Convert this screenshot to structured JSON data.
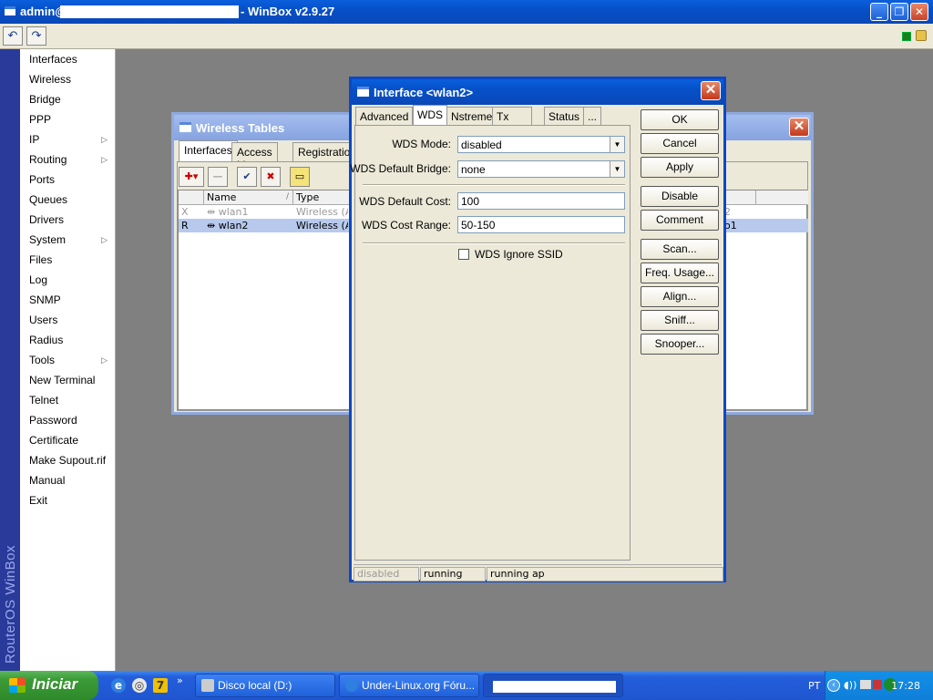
{
  "titlebar": {
    "title_prefix": "admin@",
    "title_suffix": "- WinBox v2.9.27"
  },
  "sidebar": {
    "brand": "RouterOS WinBox",
    "items": [
      {
        "label": "Interfaces",
        "arrow": false
      },
      {
        "label": "Wireless",
        "arrow": false
      },
      {
        "label": "Bridge",
        "arrow": false
      },
      {
        "label": "PPP",
        "arrow": false
      },
      {
        "label": "IP",
        "arrow": true
      },
      {
        "label": "Routing",
        "arrow": true
      },
      {
        "label": "Ports",
        "arrow": false
      },
      {
        "label": "Queues",
        "arrow": false
      },
      {
        "label": "Drivers",
        "arrow": false
      },
      {
        "label": "System",
        "arrow": true
      },
      {
        "label": "Files",
        "arrow": false
      },
      {
        "label": "Log",
        "arrow": false
      },
      {
        "label": "SNMP",
        "arrow": false
      },
      {
        "label": "Users",
        "arrow": false
      },
      {
        "label": "Radius",
        "arrow": false
      },
      {
        "label": "Tools",
        "arrow": true
      },
      {
        "label": "New Terminal",
        "arrow": false
      },
      {
        "label": "Telnet",
        "arrow": false
      },
      {
        "label": "Password",
        "arrow": false
      },
      {
        "label": "Certificate",
        "arrow": false
      },
      {
        "label": "Make Supout.rif",
        "arrow": false
      },
      {
        "label": "Manual",
        "arrow": false
      },
      {
        "label": "Exit",
        "arrow": false
      }
    ]
  },
  "wireless_tables": {
    "title": "Wireless Tables",
    "tabs": [
      "Interfaces",
      "Access List",
      "Registration"
    ],
    "columns": {
      "name": "Name",
      "type": "Type"
    },
    "rows": [
      {
        "flag": "X",
        "name": "wlan1",
        "type": "Wireless (Ath",
        "extra": "2"
      },
      {
        "flag": "R",
        "name": "wlan2",
        "type": "Wireless (Ath",
        "extra": "o1"
      }
    ]
  },
  "dialog": {
    "title": "Interface <wlan2>",
    "tabs": [
      "Advanced",
      "WDS",
      "Nstreme",
      "Tx Power",
      "Status",
      "..."
    ],
    "active_tab": "WDS",
    "fields": {
      "wds_mode_label": "WDS Mode:",
      "wds_mode_value": "disabled",
      "wds_bridge_label": "WDS Default Bridge:",
      "wds_bridge_value": "none",
      "wds_cost_label": "WDS Default Cost:",
      "wds_cost_value": "100",
      "wds_range_label": "WDS Cost Range:",
      "wds_range_value": "50-150",
      "wds_ignore_label": "WDS Ignore SSID"
    },
    "buttons": {
      "ok": "OK",
      "cancel": "Cancel",
      "apply": "Apply",
      "disable": "Disable",
      "comment": "Comment",
      "scan": "Scan...",
      "freq": "Freq. Usage...",
      "align": "Align...",
      "sniff": "Sniff...",
      "snooper": "Snooper..."
    },
    "status": [
      "disabled",
      "running",
      "running ap"
    ]
  },
  "taskbar": {
    "start": "Iniciar",
    "tasks": [
      "Disco local (D:)",
      "Under-Linux.org Fóru..."
    ],
    "lang": "PT",
    "clock": "17:28"
  }
}
